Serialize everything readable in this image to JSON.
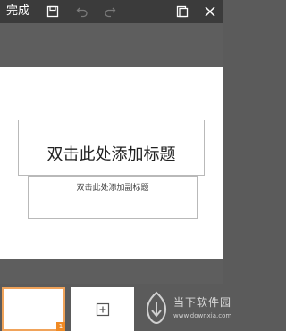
{
  "toolbar": {
    "done_label": "完成",
    "icons": [
      "save-icon",
      "undo-icon",
      "redo-icon",
      "pages-icon",
      "close-icon"
    ]
  },
  "slide": {
    "title_placeholder": "双击此处添加标题",
    "subtitle_placeholder": "双击此处添加副标题"
  },
  "thumbnails": {
    "current_slide_number": "1",
    "add_icon": "plus-icon"
  },
  "watermark": {
    "title": "当下软件园",
    "url": "www.downxia.com"
  },
  "colors": {
    "toolbar_bg": "#3b3b3b",
    "workspace_bg": "#5e5e5e",
    "accent": "#f08a24"
  }
}
